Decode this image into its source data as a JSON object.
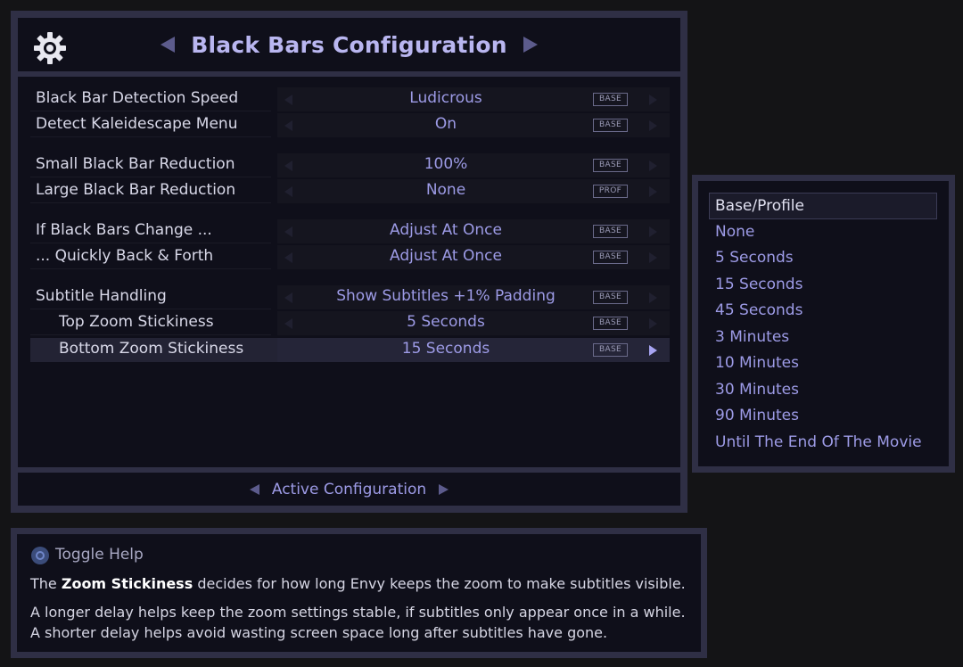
{
  "header": {
    "title": "Black Bars Configuration"
  },
  "rows": [
    {
      "label": "Black Bar Detection Speed",
      "value": "Ludicrous",
      "tag": "BASE"
    },
    {
      "label": "Detect Kaleidescape Menu",
      "value": "On",
      "tag": "BASE"
    },
    {
      "label": "Small Black Bar Reduction",
      "value": "100%",
      "tag": "BASE"
    },
    {
      "label": "Large Black Bar Reduction",
      "value": "None",
      "tag": "PROF"
    },
    {
      "label": "If Black Bars Change ...",
      "value": "Adjust At Once",
      "tag": "BASE"
    },
    {
      "label": "... Quickly Back & Forth",
      "value": "Adjust At Once",
      "tag": "BASE"
    },
    {
      "label": "Subtitle Handling",
      "value": "Show Subtitles +1% Padding",
      "tag": "BASE"
    },
    {
      "label": "Top Zoom Stickiness",
      "value": "5 Seconds",
      "tag": "BASE"
    },
    {
      "label": "Bottom Zoom Stickiness",
      "value": "15 Seconds",
      "tag": "BASE",
      "selected": true
    }
  ],
  "footer": {
    "label": "Active Configuration"
  },
  "dropdown": {
    "options": [
      "Base/Profile",
      "None",
      "5 Seconds",
      "15 Seconds",
      "45 Seconds",
      "3 Minutes",
      "10 Minutes",
      "30 Minutes",
      "90 Minutes",
      "Until The End Of The Movie"
    ],
    "selected": "Base/Profile"
  },
  "help": {
    "title": "Toggle Help",
    "line1_prefix": "The ",
    "line1_bold": "Zoom Stickiness",
    "line1_suffix": " decides for how long Envy keeps the zoom to make subtitles visible.",
    "line2": "A longer delay helps keep the zoom settings stable, if subtitles only appear once in a while.",
    "line3": "A shorter delay helps avoid wasting screen space long after subtitles have gone."
  },
  "icons": {
    "settings": "gear-icon",
    "help": "help-circle-icon"
  },
  "colors": {
    "accent": "#9d9be6",
    "title": "#b9b6f0",
    "frame": "#2f2f45",
    "background": "#0f0f1a"
  }
}
